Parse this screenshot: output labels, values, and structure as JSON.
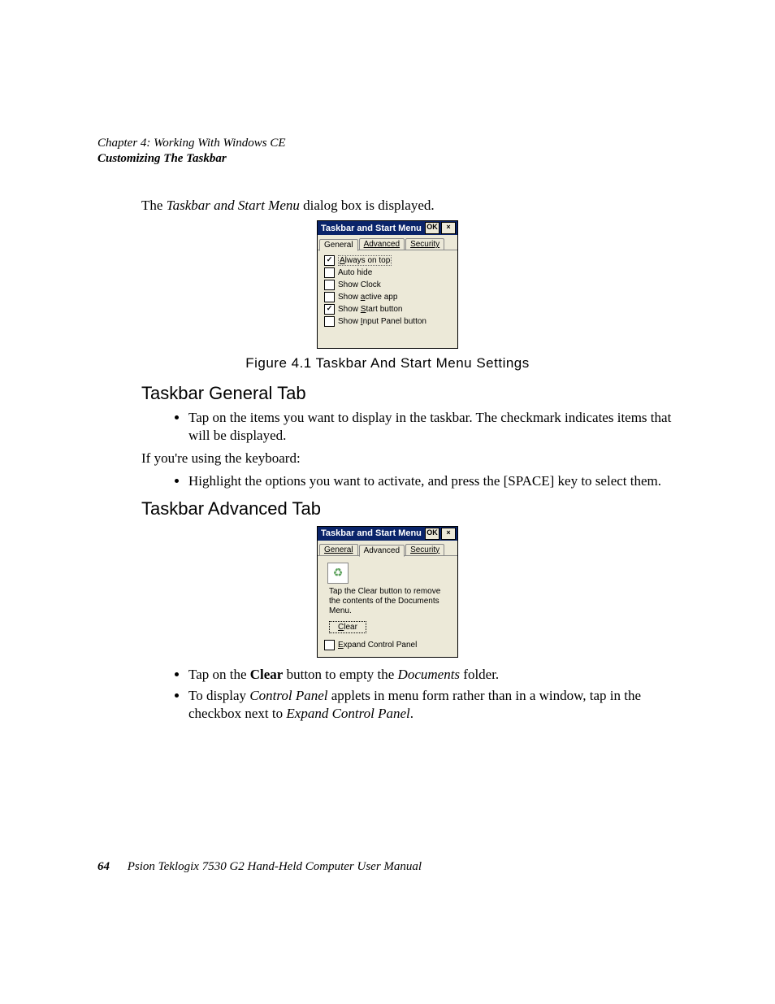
{
  "header": {
    "chapter": "Chapter 4: Working With Windows CE",
    "section": "Customizing The Taskbar"
  },
  "intro": {
    "prefix": "The ",
    "em": "Taskbar and Start Menu",
    "suffix": " dialog box is displayed."
  },
  "dialog1": {
    "title": "Taskbar and Start Menu",
    "ok": "OK",
    "close": "×",
    "tabs": {
      "general": "General",
      "advanced": "Advanced",
      "security": "Security"
    },
    "opts": {
      "always": {
        "pre": "A",
        "rest": "lways on top",
        "checked": true
      },
      "autohide": {
        "pre": "",
        "rest": "Auto hide",
        "checked": false
      },
      "clock": {
        "pre": "",
        "rest": "Show Clock",
        "checked": false
      },
      "active": {
        "rest_a": "Show ",
        "u": "a",
        "rest_b": "ctive app",
        "checked": false
      },
      "start": {
        "rest_a": "Show ",
        "u": "S",
        "rest_b": "tart button",
        "checked": true
      },
      "input": {
        "rest_a": "Show ",
        "u": "I",
        "rest_b": "nput Panel button",
        "checked": false
      }
    }
  },
  "fig1": "Figure 4.1 Taskbar And Start Menu Settings",
  "h_general": "Taskbar General Tab",
  "bul_general": "Tap on the items you want to display in the taskbar. The checkmark indicates items that will be displayed.",
  "p_keyboard": "If you're using the keyboard:",
  "bul_keyboard": "Highlight the options you want to activate, and press the [SPACE] key to select them.",
  "h_advanced": "Taskbar Advanced Tab",
  "dialog2": {
    "title": "Taskbar and Start Menu",
    "ok": "OK",
    "close": "×",
    "tabs": {
      "general": "General",
      "advanced": "Advanced",
      "security": "Security"
    },
    "desc": "Tap the Clear button to remove the contents of the Documents Menu.",
    "clear": {
      "u": "C",
      "rest": "lear"
    },
    "expand": {
      "u": "E",
      "rest": "xpand Control Panel",
      "checked": false
    }
  },
  "bul_adv1": {
    "a": "Tap on the ",
    "b": "Clear",
    "c": " button to empty the ",
    "d": "Documents",
    "e": " folder."
  },
  "bul_adv2": {
    "a": "To display ",
    "b": "Control Panel",
    "c": " applets in menu form rather than in a window, tap in the checkbox next to ",
    "d": "Expand Control Panel",
    "e": "."
  },
  "footer": {
    "page": "64",
    "manual": "Psion Teklogix 7530 G2 Hand-Held Computer User Manual"
  }
}
